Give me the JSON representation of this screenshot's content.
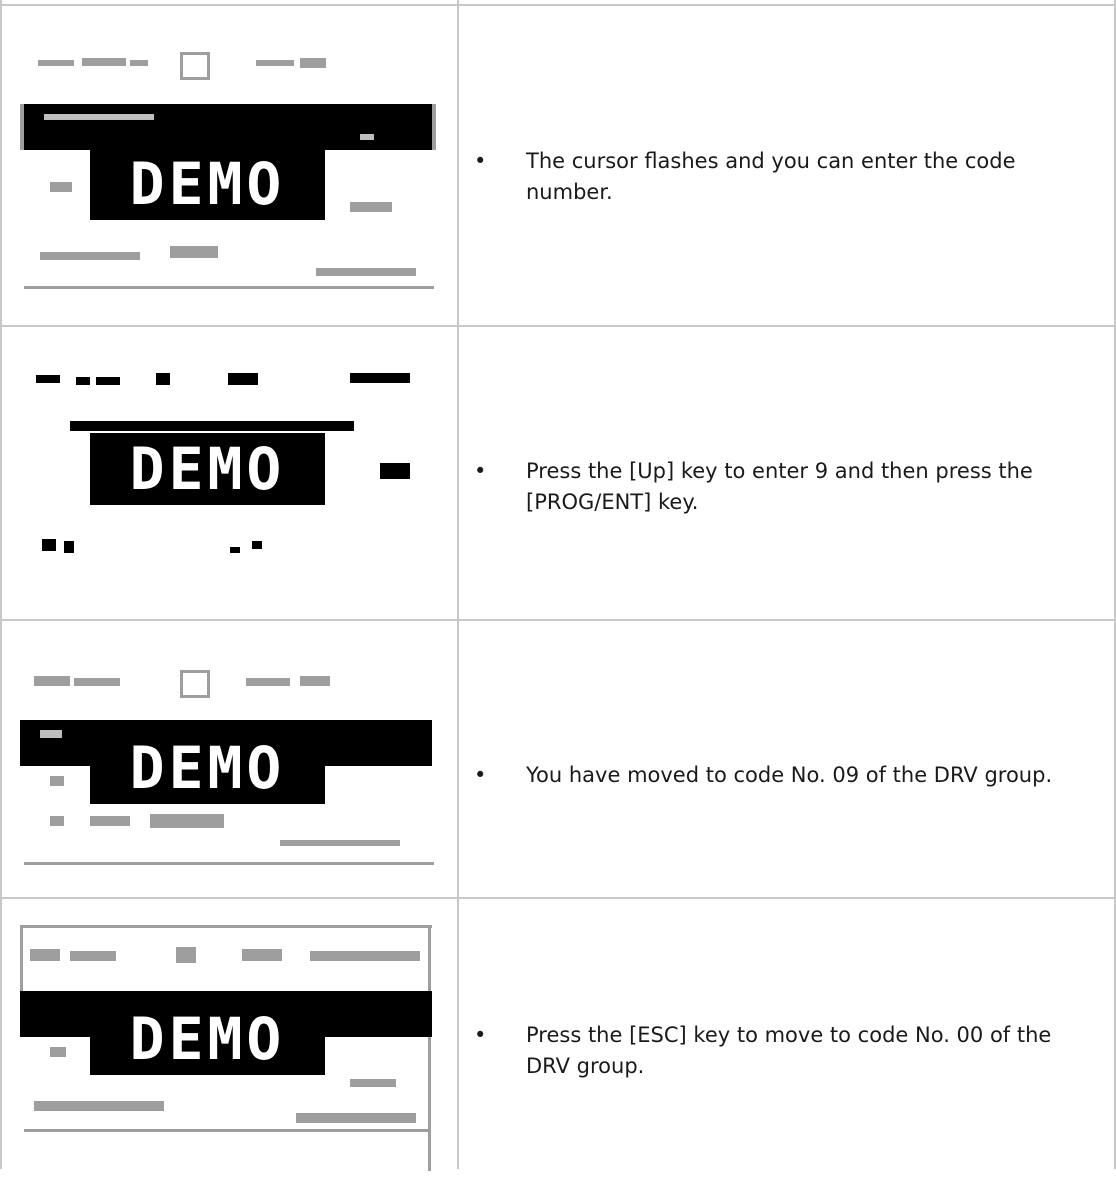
{
  "watermark": "DEMO",
  "steps": [
    {
      "bullet": "•",
      "text": "The cursor flashes and you can enter the code number."
    },
    {
      "bullet": "•",
      "text": "Press the [Up] key to enter 9 and then press the [PROG/ENT] key."
    },
    {
      "bullet": "•",
      "text": "You have moved to code No. 09 of the DRV group."
    },
    {
      "bullet": "•",
      "text": "Press the [ESC] key to move to code No. 00 of the DRV group."
    }
  ]
}
